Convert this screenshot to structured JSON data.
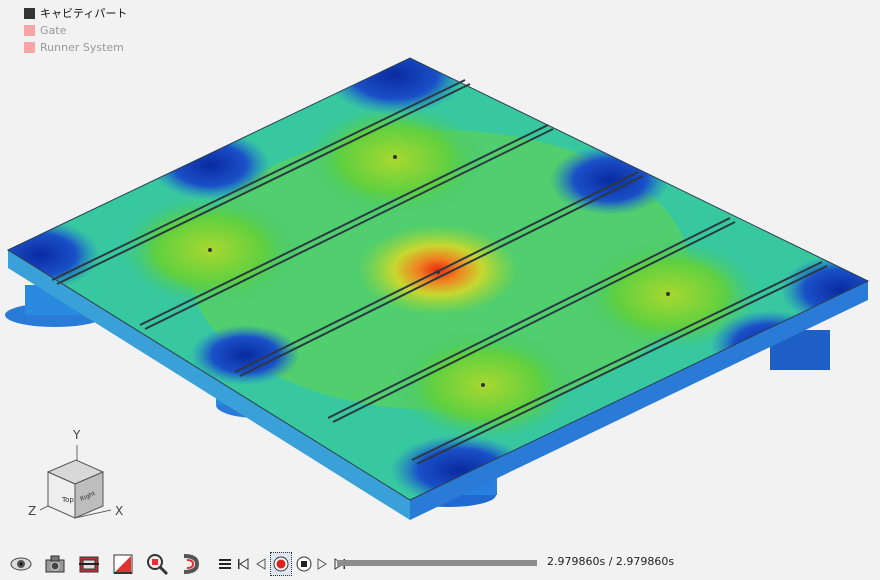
{
  "legend": {
    "items": [
      {
        "label": "キャビティパート",
        "color": "#333333"
      },
      {
        "label": "Gate",
        "color": "#f7a6a6"
      },
      {
        "label": "Runner System",
        "color": "#f7a6a6"
      }
    ]
  },
  "axes": {
    "y": "Y",
    "x": "X",
    "z": "Z",
    "cube_face": "Top",
    "cube_side": "Right"
  },
  "toolbar": {
    "icons": [
      "eye-icon",
      "camera-icon",
      "cross-section-icon",
      "chart-icon",
      "zoom-icon",
      "flow-icon"
    ],
    "playback": [
      "list-icon",
      "skip-start-icon",
      "step-back-icon",
      "record-icon",
      "stop-icon",
      "step-forward-icon",
      "skip-end-icon"
    ]
  },
  "time": {
    "text": "2.979860s / 2.979860s",
    "progress": 1.0
  },
  "colors": {
    "hot": "#e03010",
    "warm": "#e8d020",
    "mid": "#60d030",
    "cool": "#20b8b0",
    "cold": "#1030b0"
  }
}
